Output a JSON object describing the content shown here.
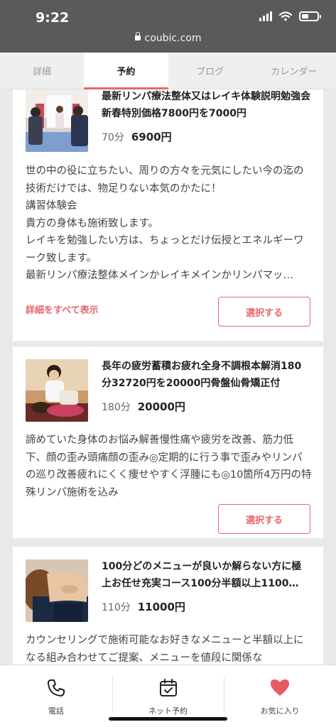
{
  "status": {
    "time": "9:22",
    "battery_level": 0.45
  },
  "browser": {
    "url": "coubic.com"
  },
  "tabs": [
    {
      "label": "詳細",
      "active": false
    },
    {
      "label": "予約",
      "active": true
    },
    {
      "label": "ブログ",
      "active": false
    },
    {
      "label": "カレンダー",
      "active": false
    }
  ],
  "menus": [
    {
      "title": "最新リンパ療法整体又はレイキ体験説明勉強会新春特別価格7800円を7000円",
      "duration": "70分",
      "price": "6900円",
      "description": "世の中の役に立ちたい、周りの方々を元気にしたい今の迄の技術だけでは、物足りない本気のかたに！\n講習体験会\n貴方の身体も施術致します。\nレイキを勉強したい方は、ちょっとだけ伝授とエネルギーワーク致します。\n最新リンパ療法整体メインかレイキメインかリンパマッ…",
      "more_label": "詳細をすべて表示",
      "select_label": "選択する"
    },
    {
      "title": "長年の疲労蓄積お疲れ全身不調根本解消180分32720円を20000円骨盤仙骨矯正付",
      "duration": "180分",
      "price": "20000円",
      "description": "諦めていた身体のお悩み解善慢性痛や疲労を改善、筋力低下、顔の歪み頭痛顔の歪み◎定期的に行う事で歪みやリンパの巡り改善疲れにくく痩せやすく浮腫にも◎10箇所4万円の特殊リンパ施術を込み",
      "select_label": "選択する"
    },
    {
      "title": "100分どのメニューが良いか解らない方に極上お任せ充実コース100分半額以上1100…",
      "duration": "110分",
      "price": "11000円",
      "description": "カウンセリングで施術可能なお好きなメニューと半額以上になる組み合わせてご提案、メニューを値段に関係な"
    }
  ],
  "bottom_nav": [
    {
      "label": "電話",
      "icon": "phone-icon"
    },
    {
      "label": "ネット予約",
      "icon": "calendar-check-icon"
    },
    {
      "label": "お気に入り",
      "icon": "heart-icon"
    }
  ],
  "colors": {
    "accent": "#e8676b",
    "status_bar": "#5a5a5a"
  }
}
